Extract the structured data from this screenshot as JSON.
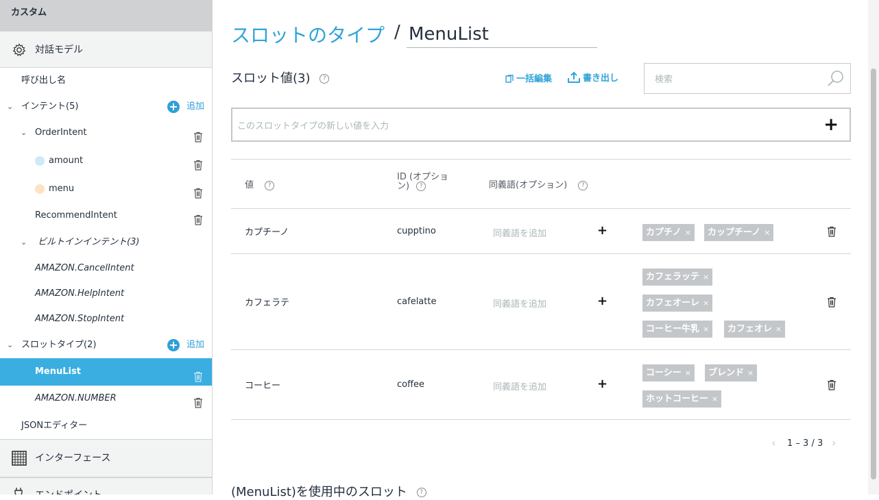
{
  "sidebar": {
    "header": "カスタム",
    "section_dialog": "対話モデル",
    "invocation": "呼び出し名",
    "intents": {
      "label": "インテント(5)",
      "add": "追加"
    },
    "order_intent": "OrderIntent",
    "slot_amount": "amount",
    "slot_menu": "menu",
    "recommend_intent": "RecommendIntent",
    "builtin": "ビルトインインテント(3)",
    "cancel": "AMAZON.CancelIntent",
    "help": "AMAZON.HelpIntent",
    "stop": "AMAZON.StopIntent",
    "slot_types": {
      "label": "スロットタイプ(2)",
      "add": "追加"
    },
    "menulist": "MenuList",
    "number": "AMAZON.NUMBER",
    "json_editor": "JSONエディター",
    "section_interface": "インターフェース",
    "section_endpoint": "エンドポイント"
  },
  "main": {
    "breadcrumb_link": "スロットのタイプ",
    "breadcrumb_sep": "/",
    "slot_type_name": "MenuList",
    "values_title": "スロット値(3)",
    "bulk_edit": "一括編集",
    "export": "書き出し",
    "search_placeholder": "検索",
    "new_value_placeholder": "このスロットタイプの新しい値を入力",
    "col_value": "値",
    "col_id_1": "ID (オプショ",
    "col_id_2": "ン)",
    "col_synonyms": "同義語(オプション)",
    "add_synonym_placeholder": "同義語を追加",
    "rows": [
      {
        "value": "カプチーノ",
        "id": "cupptino",
        "synonyms": [
          "カプチノ",
          "カップチーノ"
        ]
      },
      {
        "value": "カフェラテ",
        "id": "cafelatte",
        "synonyms": [
          "カフェラッテ",
          "カフェオーレ",
          "コーヒー牛乳",
          "カフェオレ"
        ]
      },
      {
        "value": "コーヒー",
        "id": "coffee",
        "synonyms": [
          "コーシー",
          "ブレンド",
          "ホットコーヒー"
        ]
      }
    ],
    "pagination": "1 – 3 / 3",
    "usage_title": "(MenuList)を使用中のスロット"
  },
  "colors": {
    "accent": "#2fa4d8",
    "active": "#3aaee0",
    "chip": "#c4c7ca",
    "amount_dot": "#cfe9f8",
    "menu_dot": "#fde3c6"
  }
}
